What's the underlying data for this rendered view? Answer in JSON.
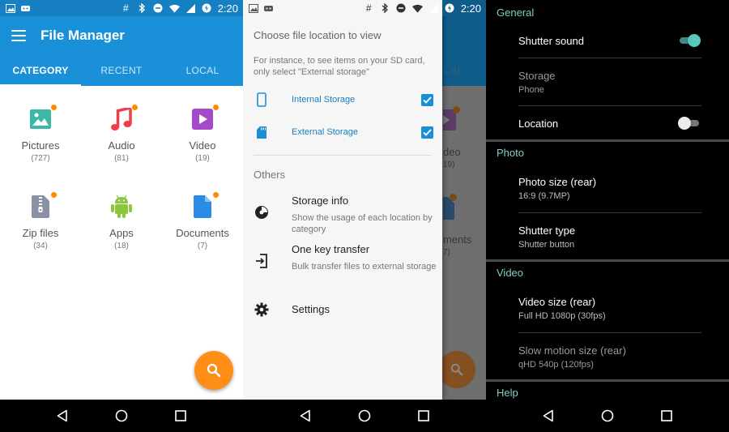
{
  "status_bar": {
    "time": "2:20"
  },
  "file_manager": {
    "title": "File Manager",
    "tabs": [
      {
        "label": "CATEGORY",
        "active": true
      },
      {
        "label": "RECENT",
        "active": false
      },
      {
        "label": "LOCAL",
        "active": false
      }
    ],
    "categories": [
      {
        "label": "Pictures",
        "count": "(727)",
        "icon": "pictures-icon",
        "color": "#3db7a6",
        "new": true
      },
      {
        "label": "Audio",
        "count": "(81)",
        "icon": "music-note-icon",
        "color": "#ef3e4a",
        "new": true
      },
      {
        "label": "Video",
        "count": "(19)",
        "icon": "video-icon",
        "color": "#a54bc9",
        "new": true
      },
      {
        "label": "Zip files",
        "count": "(34)",
        "icon": "zip-icon",
        "color": "#8892a4",
        "new": true
      },
      {
        "label": "Apps",
        "count": "(18)",
        "icon": "android-icon",
        "color": "#8cc63f",
        "new": false
      },
      {
        "label": "Documents",
        "count": "(7)",
        "icon": "document-icon",
        "color": "#2b8be6",
        "new": true
      }
    ],
    "fab": {
      "icon": "search-icon",
      "color": "#ff8e16"
    }
  },
  "drawer": {
    "heading": "Choose file location to view",
    "hint": "For instance, to see items on your SD card, only select \"External storage\"",
    "storage": [
      {
        "label": "Internal Storage",
        "icon": "phone-icon",
        "checked": true
      },
      {
        "label": "External Storage",
        "icon": "sd-card-icon",
        "checked": true
      }
    ],
    "others_heading": "Others",
    "items": [
      {
        "title": "Storage info",
        "desc": "Show the usage of each location by category",
        "icon": "pie-chart-icon"
      },
      {
        "title": "One key transfer",
        "desc": "Bulk transfer files to external storage",
        "icon": "transfer-icon"
      },
      {
        "title": "Settings",
        "desc": "",
        "icon": "gear-icon"
      }
    ],
    "background_fragments": [
      "CAL",
      "deo",
      "19)",
      "ments",
      "7)"
    ]
  },
  "settings": {
    "sections": [
      {
        "heading": "General"
      },
      {
        "heading": "Photo"
      },
      {
        "heading": "Video"
      },
      {
        "heading": "Help"
      }
    ],
    "general": {
      "shutter_sound": {
        "title": "Shutter sound",
        "on": true
      },
      "storage": {
        "title": "Storage",
        "value": "Phone"
      },
      "location": {
        "title": "Location",
        "on": false
      }
    },
    "photo": {
      "photo_size": {
        "title": "Photo size (rear)",
        "value": "16:9 (9.7MP)"
      },
      "shutter_type": {
        "title": "Shutter type",
        "value": "Shutter button"
      }
    },
    "video": {
      "video_size": {
        "title": "Video size (rear)",
        "value": "Full HD 1080p (30fps)"
      },
      "slow_motion": {
        "title": "Slow motion size (rear)",
        "value": "qHD 540p (120fps)"
      }
    },
    "accent_color": "#7fcfc6"
  }
}
